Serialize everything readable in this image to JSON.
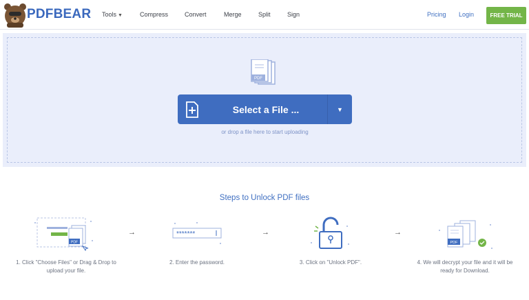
{
  "header": {
    "brand": "PDFBEAR",
    "nav": [
      {
        "label": "Tools",
        "has_caret": true
      },
      {
        "label": "Compress"
      },
      {
        "label": "Convert"
      },
      {
        "label": "Merge"
      },
      {
        "label": "Split"
      },
      {
        "label": "Sign"
      }
    ],
    "pricing": "Pricing",
    "login": "Login",
    "trial": "FREE TRIAL"
  },
  "upload": {
    "select_label": "Select a File ...",
    "hint": "or drop a file here to start uploading"
  },
  "steps": {
    "title": "Steps to Unlock PDF files",
    "items": [
      {
        "text_line1": "1. Click \"Choose Files\" or Drag & Drop to",
        "text_line2": "upload your file."
      },
      {
        "text_line1": "2. Enter the password.",
        "text_line2": ""
      },
      {
        "text_line1": "3. Click on \"Unlock PDF\".",
        "text_line2": ""
      },
      {
        "text_line1": "4. We will decrypt your file and it will be",
        "text_line2": "ready for Download."
      }
    ]
  },
  "icons": {
    "pdf_badge": "PDF"
  },
  "colors": {
    "brand_blue": "#3f6dc0",
    "trial_green": "#73b548",
    "upload_bg": "#eaeefb"
  }
}
